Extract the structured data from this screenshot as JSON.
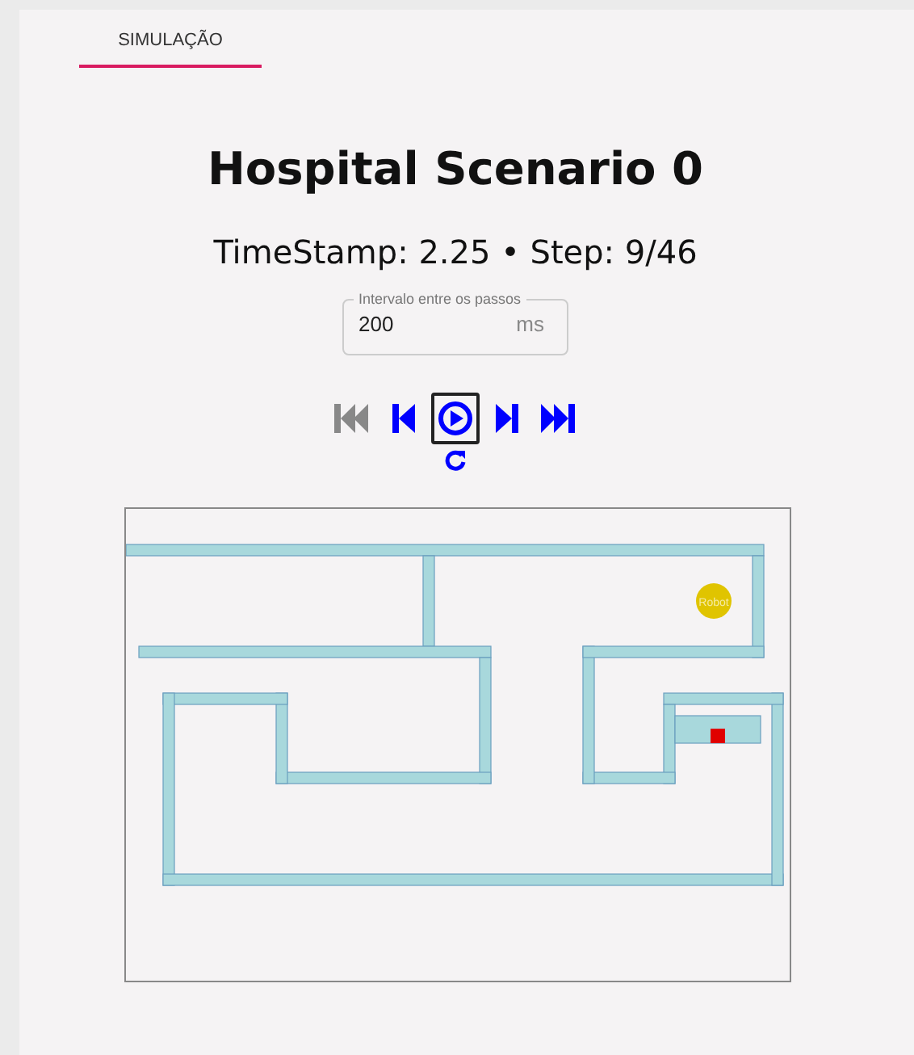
{
  "tabs": [
    {
      "label": "SIMULAÇÃO",
      "selected": true
    }
  ],
  "title": "Hospital Scenario 0",
  "status": "TimeStamp: 2.25 • Step: 9/46",
  "interval": {
    "label": "Intervalo entre os passos",
    "value": "200",
    "unit": "ms"
  },
  "controls": [
    {
      "kind": "first",
      "disabled": true,
      "selected": false
    },
    {
      "kind": "prev",
      "disabled": false,
      "selected": false
    },
    {
      "kind": "play",
      "disabled": false,
      "selected": true
    },
    {
      "kind": "next",
      "disabled": false,
      "selected": false
    },
    {
      "kind": "last",
      "disabled": false,
      "selected": false
    }
  ],
  "reload": {
    "disabled": false
  },
  "scene": {
    "robot_label": "Robot"
  }
}
